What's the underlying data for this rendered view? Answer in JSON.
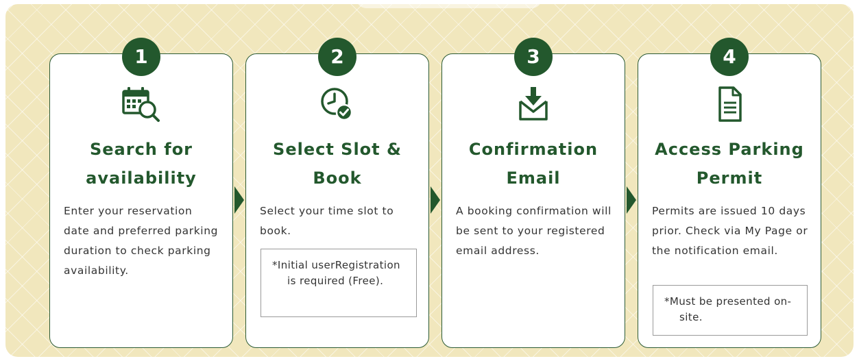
{
  "colors": {
    "accent": "#23582d",
    "panel_background": "#f1e7bd",
    "card_background": "#ffffff",
    "text": "#333333"
  },
  "steps": [
    {
      "number": "1",
      "icon": "calendar-search-icon",
      "title": "Search for availability",
      "description": "Enter your reservation date and preferred parking duration to check parking availability.",
      "note": null
    },
    {
      "number": "2",
      "icon": "clock-check-icon",
      "title": "Select Slot & Book",
      "description": "Select your time slot to book.",
      "note": "*Initial userRegistration is required (Free)."
    },
    {
      "number": "3",
      "icon": "mail-download-icon",
      "title": "Confirmation Email",
      "description": "A booking confirmation will be sent to your registered email address.",
      "note": null
    },
    {
      "number": "4",
      "icon": "document-icon",
      "title": "Access Parking Permit",
      "description": "Permits are issued 10 days prior. Check via My Page or the notification email.",
      "note": "*Must be presented on-site."
    }
  ]
}
